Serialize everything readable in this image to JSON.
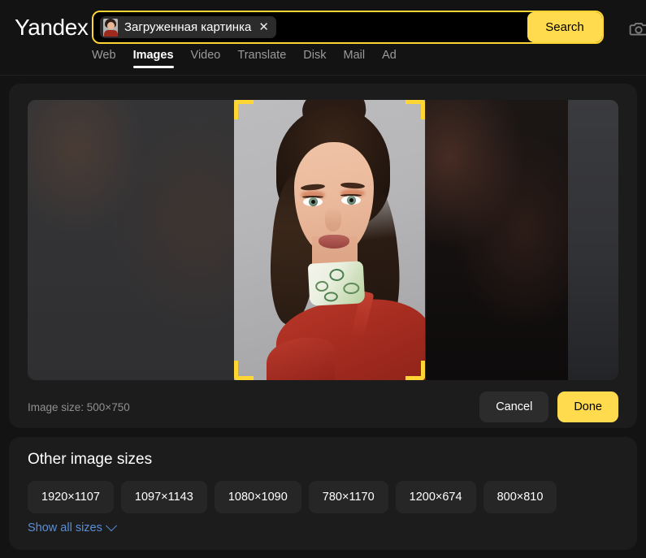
{
  "header": {
    "logo": "Yandex",
    "search": {
      "chip_label": "Загруженная картинка",
      "chip_close": "✕",
      "thumbnail_icon": "uploaded-image-thumbnail",
      "search_button": "Search",
      "camera_icon": "camera-icon"
    },
    "tabs": [
      {
        "label": "Web",
        "active": false
      },
      {
        "label": "Images",
        "active": true
      },
      {
        "label": "Video",
        "active": false
      },
      {
        "label": "Translate",
        "active": false
      },
      {
        "label": "Disk",
        "active": false
      },
      {
        "label": "Mail",
        "active": false
      },
      {
        "label": "Ad",
        "active": false
      }
    ]
  },
  "crop_card": {
    "image_size_label": "Image size: 500×750",
    "cancel_label": "Cancel",
    "done_label": "Done",
    "crop_handles_icon": "crop-corner-handle",
    "accent_color": "#ffd633"
  },
  "sizes_card": {
    "title": "Other image sizes",
    "sizes": [
      "1920×1107",
      "1097×1143",
      "1080×1090",
      "780×1170",
      "1200×674",
      "800×810"
    ],
    "show_all_label": "Show all sizes",
    "chevron_icon": "chevron-down-icon",
    "link_color": "#5a8fd6"
  },
  "theme": {
    "page_background": "#131313",
    "card_background": "#1c1c1c",
    "accent_yellow": "#ffdb4d",
    "muted_text": "#8f8f8f"
  }
}
